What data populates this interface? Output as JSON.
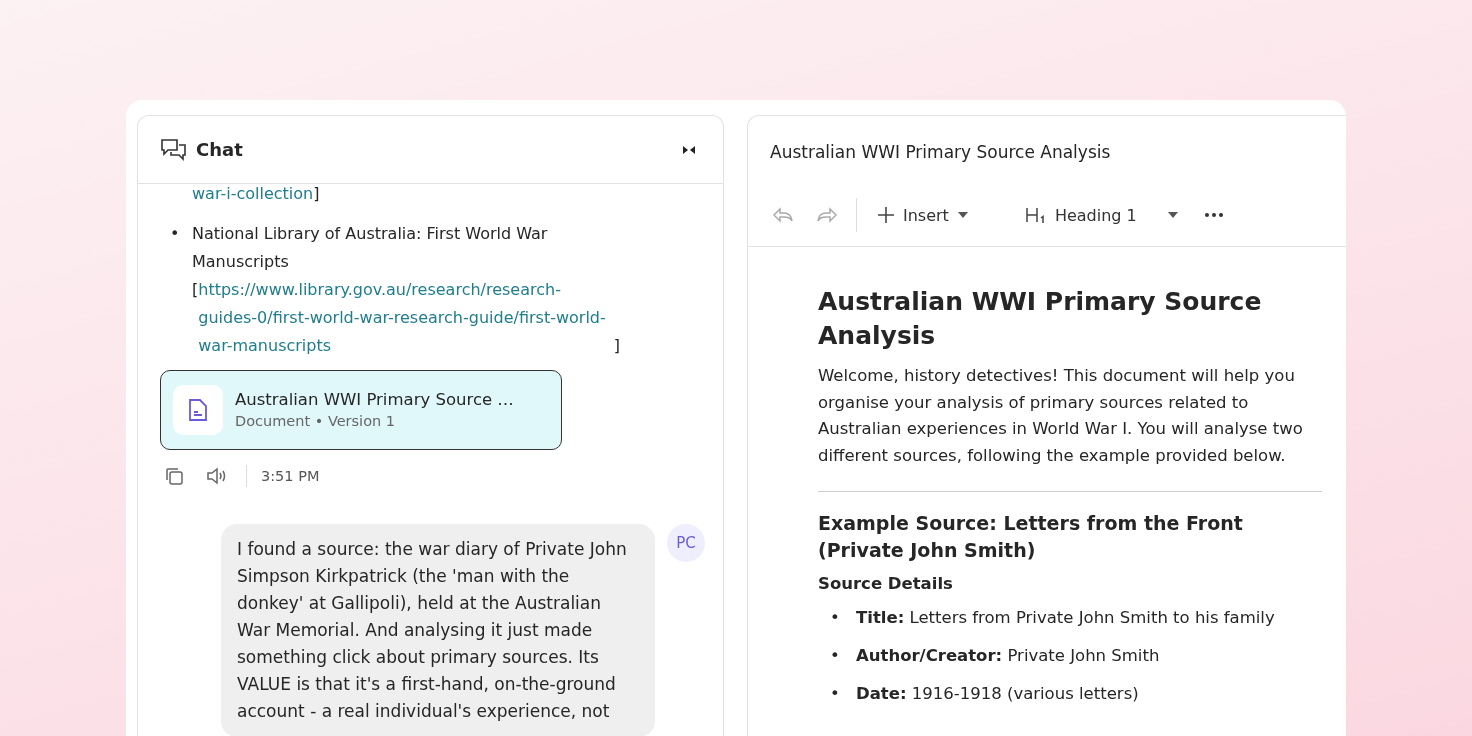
{
  "chat": {
    "title": "Chat",
    "items": [
      {
        "kind": "continuation",
        "link": "war-i-collection",
        "suffix": "]"
      },
      {
        "kind": "bullet",
        "marker": "•",
        "text": "National Library of Australia: First World War Manuscripts",
        "prefix": "[",
        "link": "https://www.library.gov.au/research/research-guides-0/first-world-war-research-guide/first-world-war-manuscripts",
        "suffix": "]"
      }
    ],
    "artifact": {
      "title": "Australian WWI Primary Source …",
      "subtitle": "Document • Version 1"
    },
    "time": "3:51 PM",
    "user_message": {
      "avatar": "PC",
      "text": "I found a source: the war diary of Private John Simpson Kirkpatrick (the 'man with the donkey' at Gallipoli), held at the Australian War Memorial. And analysing it just made something click about primary sources. Its VALUE is that it's a first-hand, on-the-ground account - a real individual's experience, not"
    }
  },
  "document": {
    "title": "Australian WWI Primary Source Analysis",
    "toolbar": {
      "insert": "Insert",
      "style": "Heading 1"
    },
    "blocks": [
      {
        "kind": "h1",
        "text": "Australian WWI Primary Source Analysis"
      },
      {
        "kind": "p",
        "text": "Welcome, history detectives! This document will help you organise your analysis of primary sources related to Australian experiences in World War I. You will analyse two different sources, following the example provided below."
      },
      {
        "kind": "hr"
      },
      {
        "kind": "h2",
        "text": "Example Source: Letters from the Front (Private John Smith)"
      },
      {
        "kind": "h3",
        "text": "Source Details"
      },
      {
        "kind": "li",
        "marker": "•",
        "text": "**Title:** Letters from Private John Smith to his family"
      },
      {
        "kind": "li",
        "marker": "•",
        "text": "**Author/Creator:** Private John Smith"
      },
      {
        "kind": "li",
        "marker": "•",
        "text": "**Date:** 1916-1918 (various letters)"
      }
    ]
  }
}
